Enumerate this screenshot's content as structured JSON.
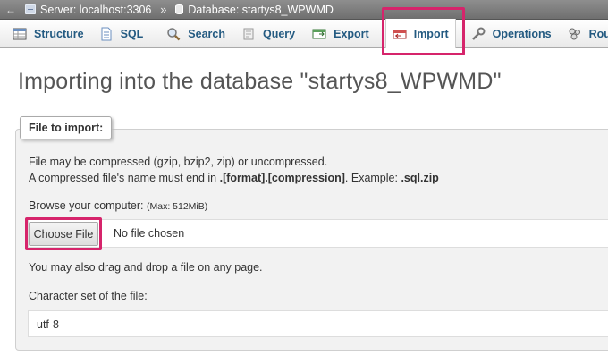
{
  "breadcrumb": {
    "server": "Server: localhost:3306",
    "separator": "»",
    "database": "Database: startys8_WPWMD",
    "arrow": "←"
  },
  "tabs": [
    {
      "label": "Structure",
      "icon": "structure-icon"
    },
    {
      "label": "SQL",
      "icon": "sql-icon"
    },
    {
      "label": "Search",
      "icon": "search-icon"
    },
    {
      "label": "Query",
      "icon": "query-icon"
    },
    {
      "label": "Export",
      "icon": "export-icon"
    },
    {
      "label": "Import",
      "icon": "import-icon",
      "active": true
    },
    {
      "label": "Operations",
      "icon": "operations-icon"
    },
    {
      "label": "Routines",
      "icon": "routines-icon"
    }
  ],
  "page_title": "Importing into the database \"startys8_WPWMD\"",
  "file_section": {
    "legend": "File to import:",
    "compress_note": "File may be compressed (gzip, bzip2, zip) or uncompressed.",
    "name_note_prefix": "A compressed file's name must end in ",
    "name_note_format": ".[format].[compression]",
    "name_note_middle": ". Example: ",
    "name_note_example": ".sql.zip",
    "browse_label": "Browse your computer: ",
    "max_size": "(Max: 512MiB)",
    "choose_button": "Choose File",
    "no_file": "No file chosen",
    "drag_note": "You may also drag and drop a file on any page.",
    "charset_label": "Character set of the file:",
    "charset_value": "utf-8"
  },
  "colors": {
    "highlight": "#d6246b",
    "tab_text": "#235a81"
  }
}
